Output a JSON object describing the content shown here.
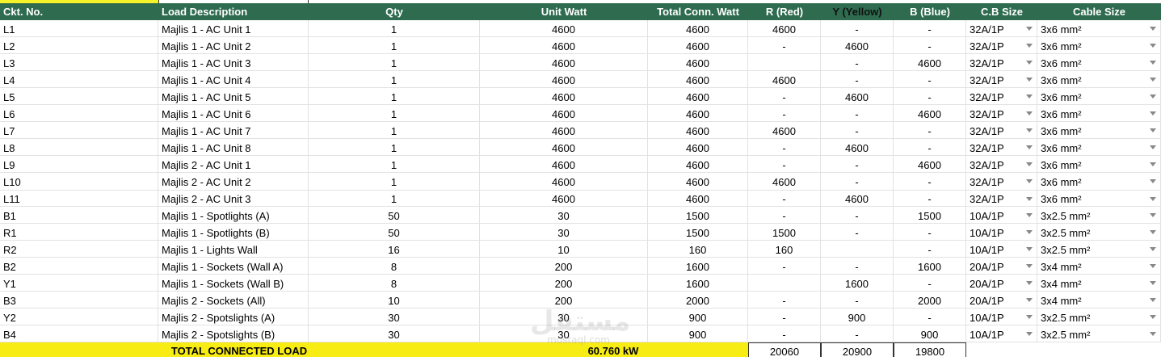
{
  "header": {
    "columns": [
      "Ckt. No.",
      "Load Description",
      "Qty",
      "Unit Watt",
      "Total Conn. Watt",
      "R (Red)",
      "Y (Yellow)",
      "B (Blue)",
      "C.B Size",
      "Cable Size"
    ]
  },
  "rows": [
    [
      "L1",
      "Majlis 1 - AC Unit 1",
      "1",
      "4600",
      "4600",
      "4600",
      "-",
      "-",
      "32A/1P",
      "3x6 mm²"
    ],
    [
      "L2",
      "Majlis 1 - AC Unit 2",
      "1",
      "4600",
      "4600",
      "-",
      "4600",
      "-",
      "32A/1P",
      "3x6 mm²"
    ],
    [
      "L3",
      "Majlis 1 - AC Unit 3",
      "1",
      "4600",
      "4600",
      "",
      "-",
      "4600",
      "32A/1P",
      "3x6 mm²"
    ],
    [
      "L4",
      "Majlis 1 - AC Unit 4",
      "1",
      "4600",
      "4600",
      "4600",
      "-",
      "-",
      "32A/1P",
      "3x6 mm²"
    ],
    [
      "L5",
      "Majlis 1 - AC Unit 5",
      "1",
      "4600",
      "4600",
      "-",
      "4600",
      "-",
      "32A/1P",
      "3x6 mm²"
    ],
    [
      "L6",
      "Majlis 1 - AC Unit 6",
      "1",
      "4600",
      "4600",
      "-",
      "-",
      "4600",
      "32A/1P",
      "3x6 mm²"
    ],
    [
      "L7",
      "Majlis 1 - AC Unit 7",
      "1",
      "4600",
      "4600",
      "4600",
      "-",
      "-",
      "32A/1P",
      "3x6 mm²"
    ],
    [
      "L8",
      "Majlis 1 - AC Unit 8",
      "1",
      "4600",
      "4600",
      "-",
      "4600",
      "-",
      "32A/1P",
      "3x6 mm²"
    ],
    [
      "L9",
      "Majlis 2 - AC Unit 1",
      "1",
      "4600",
      "4600",
      "-",
      "-",
      "4600",
      "32A/1P",
      "3x6 mm²"
    ],
    [
      "L10",
      "Majlis 2 - AC Unit 2",
      "1",
      "4600",
      "4600",
      "4600",
      "-",
      "-",
      "32A/1P",
      "3x6 mm²"
    ],
    [
      "L11",
      "Majlis 2 - AC Unit 3",
      "1",
      "4600",
      "4600",
      "-",
      "4600",
      "-",
      "32A/1P",
      "3x6 mm²"
    ],
    [
      "B1",
      "Majlis 1 - Spotlights (A)",
      "50",
      "30",
      "1500",
      "-",
      "-",
      "1500",
      "10A/1P",
      "3x2.5 mm²"
    ],
    [
      "R1",
      "Majlis 1 - Spotlights (B)",
      "50",
      "30",
      "1500",
      "1500",
      "-",
      "-",
      "10A/1P",
      "3x2.5 mm²"
    ],
    [
      "R2",
      "Majlis 1 - Lights Wall",
      "16",
      "10",
      "160",
      "160",
      "",
      "-",
      "10A/1P",
      "3x2.5 mm²"
    ],
    [
      "B2",
      "Majlis 1 - Sockets (Wall A)",
      "8",
      "200",
      "1600",
      "-",
      "-",
      "1600",
      "20A/1P",
      "3x4 mm²"
    ],
    [
      "Y1",
      "Majlis 1 - Sockets (Wall B)",
      "8",
      "200",
      "1600",
      "",
      "1600",
      "-",
      "20A/1P",
      "3x4 mm²"
    ],
    [
      "B3",
      "Majlis 2 - Sockets (All)",
      "10",
      "200",
      "2000",
      "-",
      "-",
      "2000",
      "20A/1P",
      "3x4 mm²"
    ],
    [
      "Y2",
      "Majlis 2 - Spotslights (A)",
      "30",
      "30",
      "900",
      "-",
      "900",
      "-",
      "10A/1P",
      "3x2.5 mm²"
    ],
    [
      "B4",
      "Majlis 2 - Spotslights (B)",
      "30",
      "30",
      "900",
      "-",
      "-",
      "900",
      "10A/1P",
      "3x2.5 mm²"
    ]
  ],
  "total": {
    "label": "TOTAL CONNECTED LOAD",
    "value": "60.760 kW",
    "r": "20060",
    "y": "20900",
    "b": "19800"
  },
  "watermark": {
    "arabic": "مستقل",
    "latin": "mostaql.com"
  },
  "colors": {
    "header_bg": "#2f6b4f",
    "total_bg": "#f7ec13"
  }
}
